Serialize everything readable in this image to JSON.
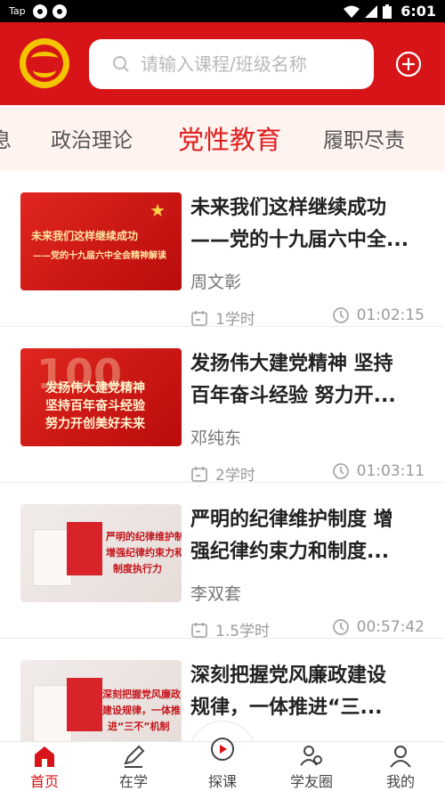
{
  "status_bar": {
    "app_label": "Tap",
    "time": "6:01"
  },
  "search": {
    "placeholder": "请输入课程/班级名称"
  },
  "tabs": [
    {
      "label": "息",
      "active": false
    },
    {
      "label": "政治理论",
      "active": false
    },
    {
      "label": "党性教育",
      "active": true
    },
    {
      "label": "履职尽责",
      "active": false
    }
  ],
  "courses": [
    {
      "title_line1": "未来我们这样继续成功",
      "title_line2": "——党的十九届六中全...",
      "author": "周文彰",
      "hours": "1学时",
      "duration": "01:02:15",
      "thumb_text1": "未来我们这样继续成功",
      "thumb_text2": "——党的十九届六中全会精神解读"
    },
    {
      "title_line1": "发扬伟大建党精神 坚持",
      "title_line2": "百年奋斗经验 努力开...",
      "author": "邓纯东",
      "hours": "2学时",
      "duration": "01:03:11",
      "thumb_text1": "发扬伟大建党精神",
      "thumb_text2": "坚持百年奋斗经验",
      "thumb_text3": "努力开创美好未来",
      "thumb_badge": "100"
    },
    {
      "title_line1": "严明的纪律维护制度 增",
      "title_line2": "强纪律约束力和制度...",
      "author": "李双套",
      "hours": "1.5学时",
      "duration": "00:57:42",
      "thumb_text1": "严明的纪律维护制度",
      "thumb_text2": "增强纪律约束力和",
      "thumb_text3": "制度执行力"
    },
    {
      "title_line1": "深刻把握党风廉政建设",
      "title_line2": "规律，一体推进“三...",
      "thumb_text1": "深刻把握党风廉政",
      "thumb_text2": "建设规律，一体推",
      "thumb_text3": "进“三不”机制"
    }
  ],
  "bottom_nav": [
    {
      "label": "首页",
      "active": true
    },
    {
      "label": "在学",
      "active": false
    },
    {
      "label": "探课",
      "active": false
    },
    {
      "label": "学友圈",
      "active": false
    },
    {
      "label": "我的",
      "active": false
    }
  ],
  "colors": {
    "brand_red": "#d71518",
    "accent_red": "#e01e1e",
    "logo_yellow": "#f5c400"
  }
}
